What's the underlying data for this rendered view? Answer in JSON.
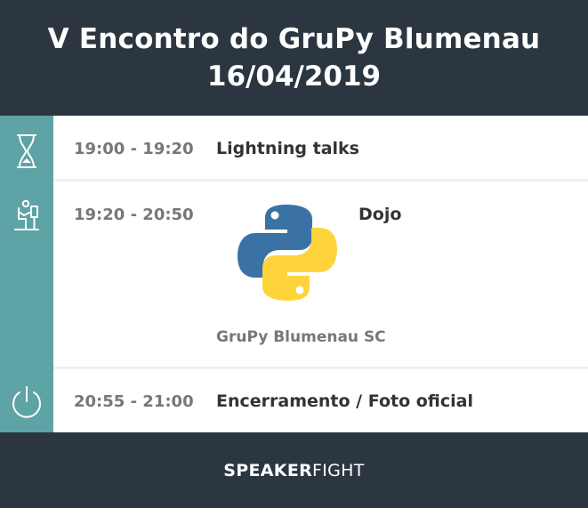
{
  "header": {
    "title": "V Encontro do GruPy Blumenau",
    "date": "16/04/2019"
  },
  "schedule": [
    {
      "time": "19:00 - 19:20",
      "title": "Lightning talks",
      "icon": "hourglass-icon"
    },
    {
      "time": "19:20 - 20:50",
      "title": "Dojo",
      "speaker": "GruPy Blumenau SC",
      "icon": "person-at-computer-icon",
      "logo": "python-logo"
    },
    {
      "time": "20:55 - 21:00",
      "title": "Encerramento / Foto oficial",
      "icon": "power-icon"
    }
  ],
  "footer": {
    "brand_bold": "SPEAKER",
    "brand_light": "FIGHT"
  },
  "colors": {
    "dark": "#2b3640",
    "sidebar": "#5ea3a6",
    "python_blue": "#3a72a4",
    "python_yellow": "#ffd43b"
  }
}
